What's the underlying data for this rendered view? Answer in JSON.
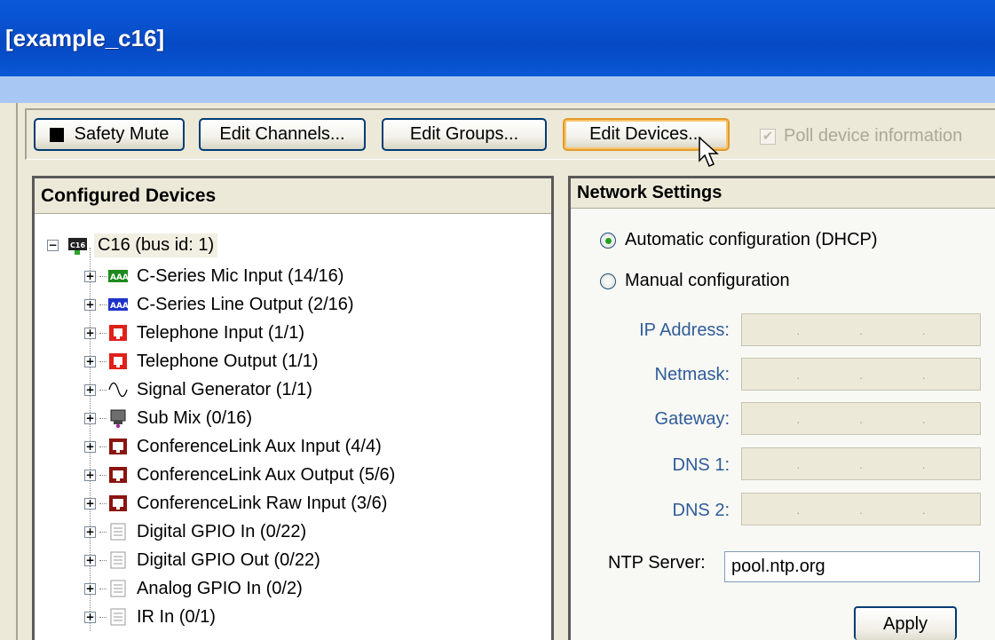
{
  "window": {
    "title": "[example_c16]"
  },
  "toolbar": {
    "safety_mute": "Safety Mute",
    "edit_channels": "Edit Channels...",
    "edit_groups": "Edit Groups...",
    "edit_devices": "Edit Devices...",
    "poll_label": "Poll device information",
    "poll_checked": true
  },
  "configured_devices": {
    "header": "Configured Devices",
    "root": {
      "badge": "C16",
      "label": "C16 (bus id: 1)"
    },
    "items": [
      {
        "label": "C-Series Mic Input (14/16)",
        "icon": "mic-input-block-icon"
      },
      {
        "label": "C-Series Line Output (2/16)",
        "icon": "line-output-block-icon"
      },
      {
        "label": "Telephone Input (1/1)",
        "icon": "telephone-icon"
      },
      {
        "label": "Telephone Output (1/1)",
        "icon": "telephone-icon"
      },
      {
        "label": "Signal Generator (1/1)",
        "icon": "signal-generator-icon"
      },
      {
        "label": "Sub Mix (0/16)",
        "icon": "submix-icon"
      },
      {
        "label": "ConferenceLink Aux Input (4/4)",
        "icon": "conferencelink-icon"
      },
      {
        "label": "ConferenceLink Aux Output (5/6)",
        "icon": "conferencelink-icon"
      },
      {
        "label": "ConferenceLink Raw Input (3/6)",
        "icon": "conferencelink-icon"
      },
      {
        "label": "Digital GPIO In (0/22)",
        "icon": "gpio-icon"
      },
      {
        "label": "Digital GPIO Out (0/22)",
        "icon": "gpio-icon"
      },
      {
        "label": "Analog GPIO In (0/2)",
        "icon": "gpio-icon"
      },
      {
        "label": "IR In (0/1)",
        "icon": "gpio-icon"
      }
    ]
  },
  "network_settings": {
    "header": "Network Settings",
    "auto_label": "Automatic configuration (DHCP)",
    "manual_label": "Manual configuration",
    "selected": "auto",
    "fields": [
      {
        "label": "IP Address:"
      },
      {
        "label": "Netmask:"
      },
      {
        "label": "Gateway:"
      },
      {
        "label": "DNS 1:"
      },
      {
        "label": "DNS 2:"
      }
    ],
    "ntp_label": "NTP Server:",
    "ntp_value": "pool.ntp.org",
    "apply_label": "Apply"
  },
  "colors": {
    "titlebar": "#0852d0",
    "menuband": "#a9c7f3",
    "window_bg": "#ece9d8",
    "button_border": "#003c74",
    "hover_border": "#e39a2a",
    "field_label": "#2f5c9a"
  }
}
